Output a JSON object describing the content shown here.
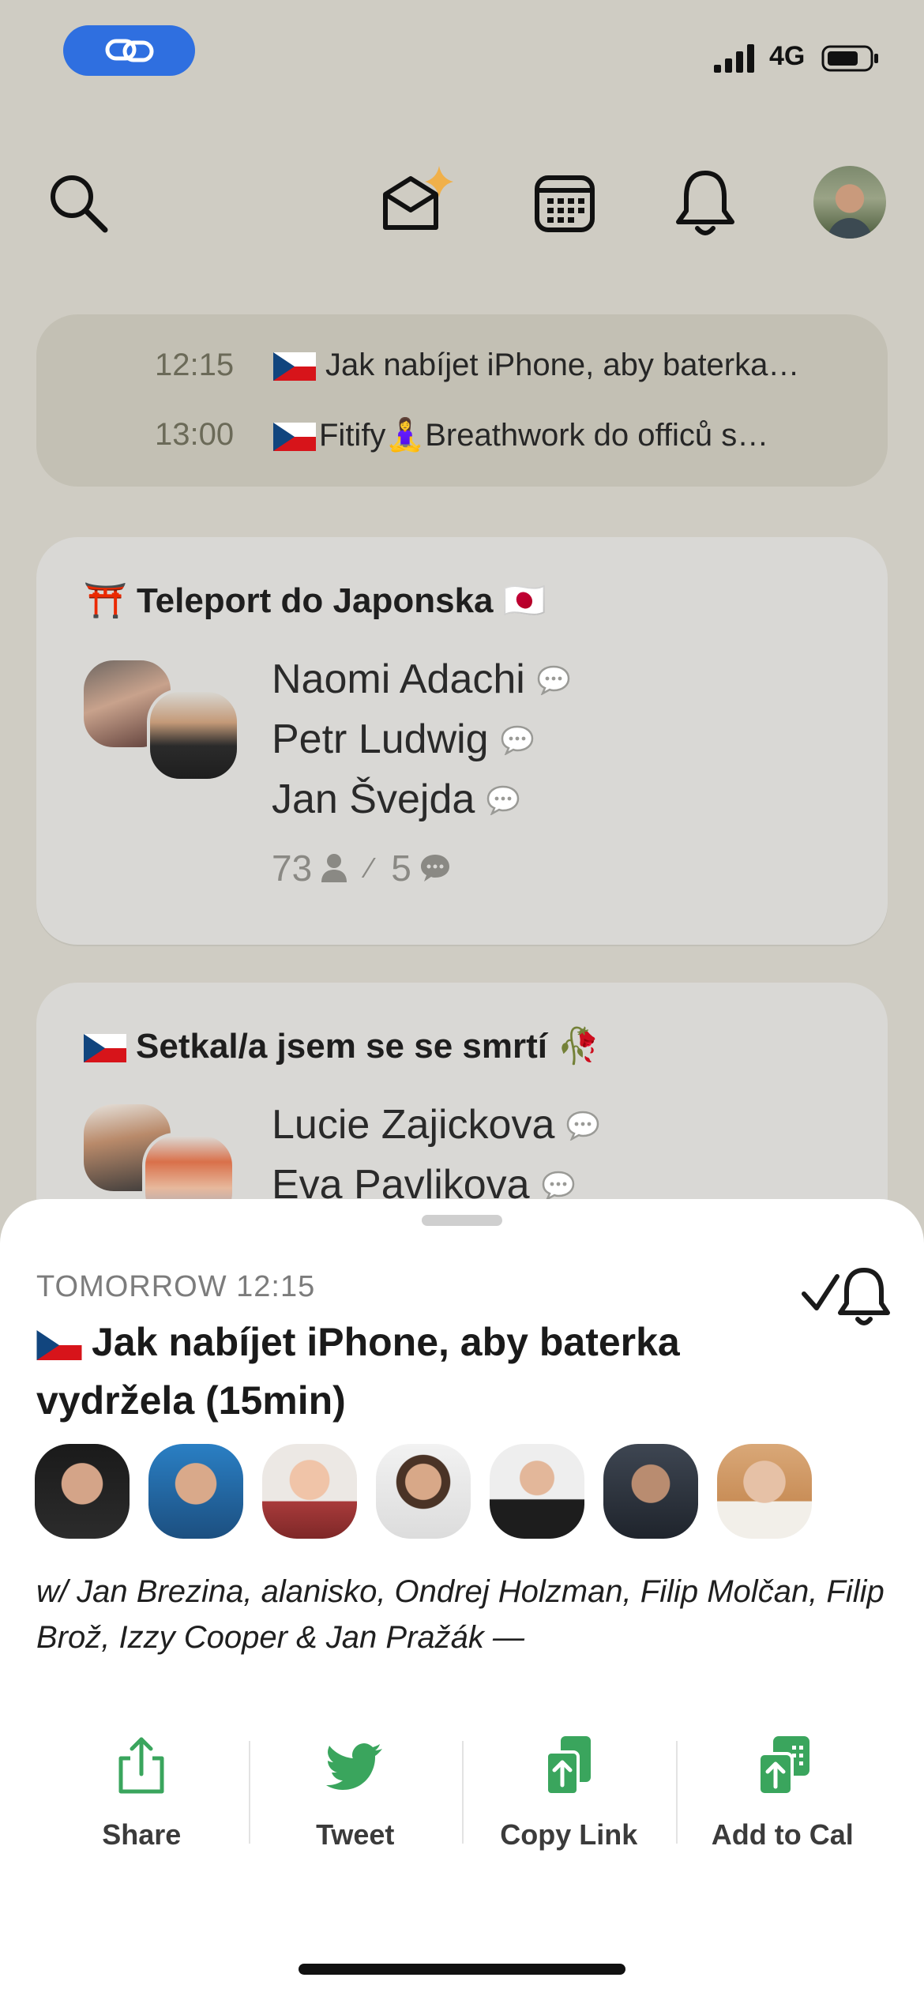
{
  "status": {
    "network": "4G"
  },
  "nav": {
    "icons": [
      "search-icon",
      "invite-icon",
      "calendar-icon",
      "bell-icon"
    ]
  },
  "upcoming": [
    {
      "time": "12:15",
      "title": "Jak nabíjet iPhone, aby baterka…"
    },
    {
      "time": "13:00",
      "title": "Fitify🧘‍♀️Breathwork do officů s…"
    }
  ],
  "rooms": [
    {
      "title": "⛩️ Teleport do Japonska 🇯🇵",
      "speakers": [
        "Naomi Adachi",
        "Petr Ludwig",
        "Jan Švejda"
      ],
      "listeners": "73",
      "speaker_count": "5"
    },
    {
      "title": "Setkal/a jsem se se smrtí 🥀",
      "speakers": [
        "Lucie Zajickova",
        "Eva Pavlikova"
      ]
    }
  ],
  "sheet": {
    "when": "TOMORROW 12:15",
    "title": "Jak nabíjet iPhone, aby baterka vydržela (15min)",
    "with_text": "w/ Jan Brezina, alanisko, Ondrej Holzman, Filip Molčan, Filip Brož, Izzy Cooper & Jan Pražák —",
    "actions": [
      {
        "label": "Share",
        "icon": "share-icon"
      },
      {
        "label": "Tweet",
        "icon": "twitter-bird-icon"
      },
      {
        "label": "Copy Link",
        "icon": "copy-link-icon"
      },
      {
        "label": "Add to Cal",
        "icon": "add-to-calendar-icon"
      }
    ],
    "accent": "#3aa55d"
  },
  "colors": {
    "background": "#cfccc3",
    "card": "#d9d8d5",
    "upcoming": "#c3c0b4",
    "pill": "#2f6fe0"
  }
}
